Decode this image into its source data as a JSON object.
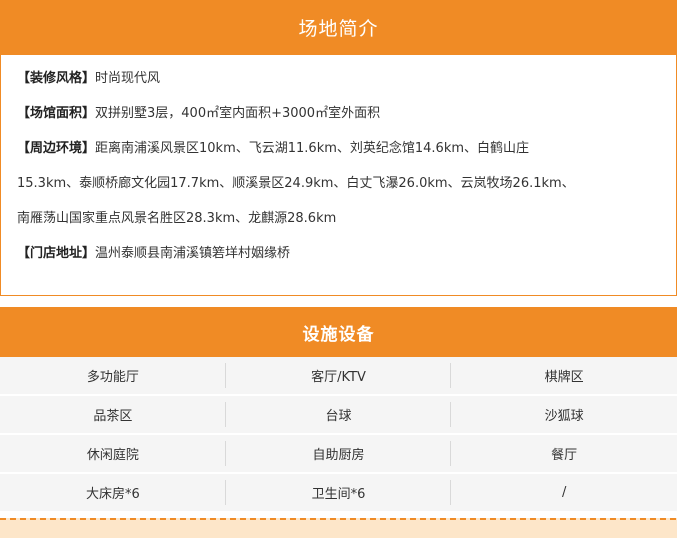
{
  "intro": {
    "title": "场地简介",
    "rows": [
      {
        "tag": "【装修风格】",
        "text": "时尚现代风"
      },
      {
        "tag": "【场馆面积】",
        "text": "双拼别墅3层，400㎡室内面积+3000㎡室外面积"
      },
      {
        "tag": "【周边环境】",
        "text": "距离南浦溪风景区10km、飞云湖11.6km、刘英纪念馆14.6km、白鹤山庄"
      },
      {
        "tag": "",
        "text": "15.3km、泰顺桥廊文化园17.7km、顺溪景区24.9km、白丈飞瀑26.0km、云岚牧场26.1km、"
      },
      {
        "tag": "",
        "text": "南雁荡山国家重点风景名胜区28.3km、龙麒源28.6km"
      },
      {
        "tag": "【门店地址】",
        "text": "温州泰顺县南浦溪镇箬垟村姻缘桥"
      }
    ]
  },
  "facilities": {
    "title": "设施设备",
    "rows": [
      [
        "多功能厅",
        "客厅/KTV",
        "棋牌区"
      ],
      [
        "品茶区",
        "台球",
        "沙狐球"
      ],
      [
        "休闲庭院",
        "自助厨房",
        "餐厅"
      ],
      [
        "大床房*6",
        "卫生间*6",
        "/"
      ]
    ]
  },
  "colors": {
    "accent": "#f08b25",
    "grid_bg": "#f5f5f5"
  }
}
